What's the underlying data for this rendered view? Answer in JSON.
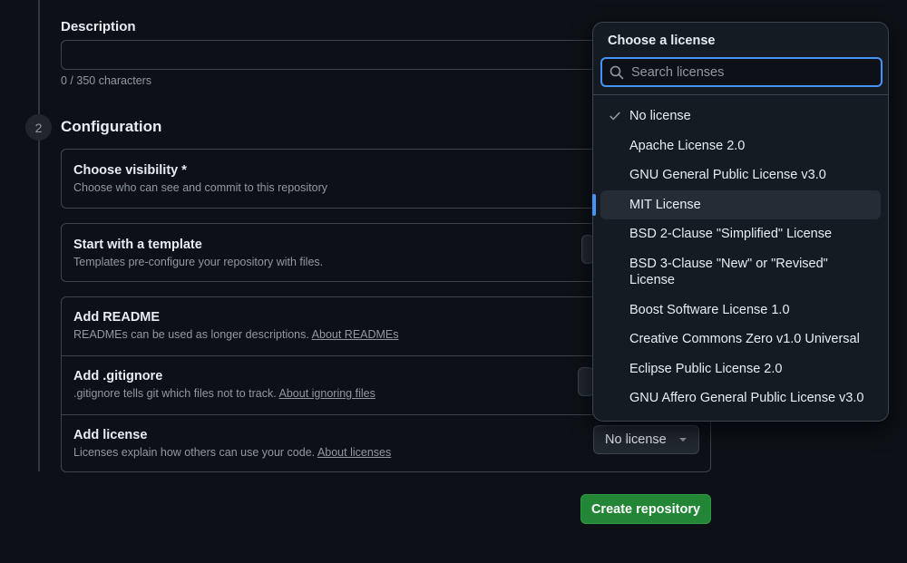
{
  "description": {
    "label": "Description",
    "value": "",
    "counter": "0 / 350 characters"
  },
  "configuration": {
    "step_number": "2",
    "title": "Configuration",
    "visibility": {
      "title": "Choose visibility *",
      "subtitle": "Choose who can see and commit to this repository"
    },
    "template": {
      "title": "Start with a template",
      "subtitle": "Templates pre-configure your repository with files."
    },
    "readme": {
      "title": "Add README",
      "subtitle": "READMEs can be used as longer descriptions.",
      "link": "About READMEs"
    },
    "gitignore": {
      "title": "Add .gitignore",
      "subtitle": ".gitignore tells git which files not to track.",
      "link": "About ignoring files"
    },
    "license": {
      "title": "Add license",
      "subtitle": "Licenses explain how others can use your code.",
      "link": "About licenses",
      "button_label": "No license"
    }
  },
  "create_button": "Create repository",
  "license_dropdown": {
    "title": "Choose a license",
    "search_placeholder": "Search licenses",
    "selected": "No license",
    "hovered": "MIT License",
    "items": [
      "No license",
      "Apache License 2.0",
      "GNU General Public License v3.0",
      "MIT License",
      "BSD 2-Clause \"Simplified\" License",
      "BSD 3-Clause \"New\" or \"Revised\" License",
      "Boost Software License 1.0",
      "Creative Commons Zero v1.0 Universal",
      "Eclipse Public License 2.0",
      "GNU Affero General Public License v3.0"
    ]
  },
  "colors": {
    "background": "#0d1117",
    "accent": "#4493f8",
    "primary_button": "#238636"
  }
}
